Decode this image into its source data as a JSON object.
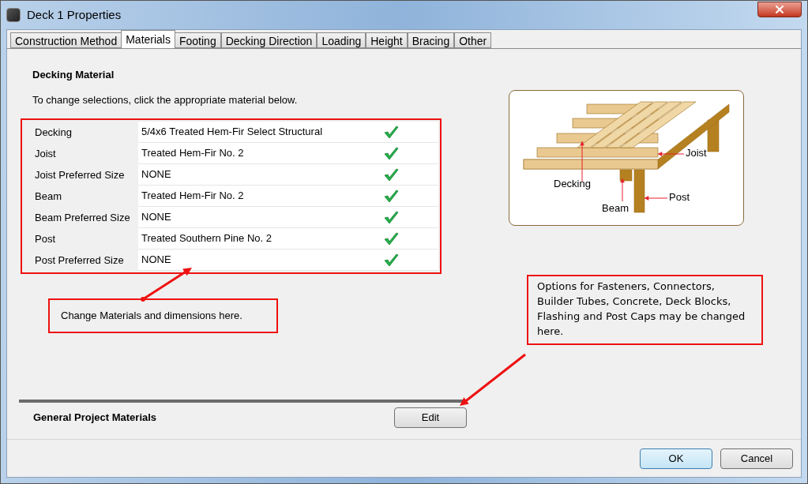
{
  "window": {
    "title": "Deck 1 Properties"
  },
  "tabs": [
    {
      "label": "Construction Method",
      "selected": false
    },
    {
      "label": "Materials",
      "selected": true
    },
    {
      "label": "Footing",
      "selected": false
    },
    {
      "label": "Decking Direction",
      "selected": false
    },
    {
      "label": "Loading",
      "selected": false
    },
    {
      "label": "Height",
      "selected": false
    },
    {
      "label": "Bracing",
      "selected": false
    },
    {
      "label": "Other",
      "selected": false
    }
  ],
  "section": {
    "heading": "Decking Material",
    "instruction": "To change selections, click the appropriate material below."
  },
  "materials": [
    {
      "label": "Decking",
      "value": "5/4x6 Treated Hem-Fir Select Structural",
      "checked": true
    },
    {
      "label": "Joist",
      "value": "Treated Hem-Fir No. 2",
      "checked": true
    },
    {
      "label": "Joist Preferred Size",
      "value": "NONE",
      "checked": true
    },
    {
      "label": "Beam",
      "value": "Treated Hem-Fir No. 2",
      "checked": true
    },
    {
      "label": "Beam Preferred Size",
      "value": "NONE",
      "checked": true
    },
    {
      "label": "Post",
      "value": "Treated Southern Pine No. 2",
      "checked": true
    },
    {
      "label": "Post Preferred Size",
      "value": "NONE",
      "checked": true
    }
  ],
  "diagram": {
    "labels": {
      "decking": "Decking",
      "joist": "Joist",
      "beam": "Beam",
      "post": "Post"
    }
  },
  "callouts": [
    "Change Materials and dimensions here.",
    "Options for Fasteners, Connectors, Builder Tubes, Concrete, Deck Blocks, Flashing and Post Caps may be changed here."
  ],
  "general": {
    "label": "General Project Materials",
    "button": "Edit"
  },
  "buttons": [
    {
      "label": "OK",
      "default": true
    },
    {
      "label": "Cancel",
      "default": false
    }
  ]
}
